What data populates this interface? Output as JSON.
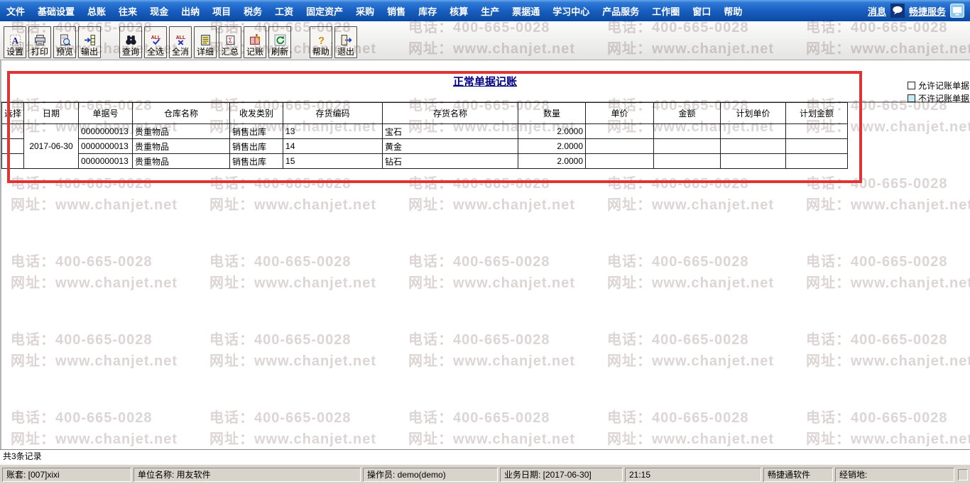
{
  "menu": {
    "items": [
      "文件",
      "基础设置",
      "总账",
      "往来",
      "现金",
      "出纳",
      "项目",
      "税务",
      "工资",
      "固定资产",
      "采购",
      "销售",
      "库存",
      "核算",
      "生产",
      "票据通",
      "学习中心",
      "产品服务",
      "工作圈",
      "窗口",
      "帮助"
    ],
    "messages_label": "消息",
    "service_label": "畅捷服务"
  },
  "toolbar": {
    "buttons": [
      {
        "label": "设置",
        "icon": "settings-icon"
      },
      {
        "label": "打印",
        "icon": "print-icon"
      },
      {
        "label": "预览",
        "icon": "preview-icon"
      },
      {
        "label": "输出",
        "icon": "export-icon"
      },
      {
        "label": "查询",
        "icon": "query-icon"
      },
      {
        "label": "全选",
        "icon": "select-all-icon"
      },
      {
        "label": "全消",
        "icon": "deselect-all-icon"
      },
      {
        "label": "详细",
        "icon": "detail-icon"
      },
      {
        "label": "汇总",
        "icon": "summary-icon"
      },
      {
        "label": "记账",
        "icon": "bookkeeping-icon"
      },
      {
        "label": "刷新",
        "icon": "refresh-icon"
      },
      {
        "label": "帮助",
        "icon": "help-icon"
      },
      {
        "label": "退出",
        "icon": "exit-icon"
      }
    ]
  },
  "page": {
    "title": "正常单据记账"
  },
  "legend": {
    "allow_label": "允许记账单据",
    "deny_label": "不许记账单据",
    "allow_fill": "#ffffff",
    "deny_fill": "#c4eef2"
  },
  "table": {
    "headers": [
      "选择",
      "日期",
      "单据号",
      "仓库名称",
      "收发类别",
      "存货编码",
      "存货名称",
      "数量",
      "单价",
      "金额",
      "计划单价",
      "计划金额"
    ],
    "date": "2017-06-30",
    "rows": [
      {
        "doc_no": "0000000013",
        "warehouse": "贵重物品",
        "category": "销售出库",
        "code": "13",
        "name": "宝石",
        "qty": "2.0000",
        "price": "",
        "amount": "",
        "plan_price": "",
        "plan_amount": ""
      },
      {
        "doc_no": "0000000013",
        "warehouse": "贵重物品",
        "category": "销售出库",
        "code": "14",
        "name": "黄金",
        "qty": "2.0000",
        "price": "",
        "amount": "",
        "plan_price": "",
        "plan_amount": ""
      },
      {
        "doc_no": "0000000013",
        "warehouse": "贵重物品",
        "category": "销售出库",
        "code": "15",
        "name": "钻石",
        "qty": "2.0000",
        "price": "",
        "amount": "",
        "plan_price": "",
        "plan_amount": ""
      }
    ]
  },
  "footer": {
    "record_count": "共3条记录"
  },
  "statusbar": {
    "panels": [
      "账套: [007]xixi",
      "单位名称: 用友软件",
      "操作员: demo(demo)",
      "业务日期: [2017-06-30]",
      "21:15",
      "畅捷通软件",
      "经销地:"
    ]
  },
  "watermark": {
    "phone": "电话：400-665-0028",
    "url": "网址：www.chanjet.net"
  },
  "colors": {
    "annotation_red": "#e03434",
    "title_navy": "#000082",
    "menu_blue": "#1b62c4",
    "watermark_gray": "#ddd5d5"
  }
}
